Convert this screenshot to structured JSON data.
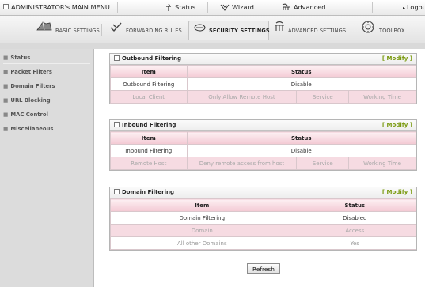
{
  "topbar": {
    "admin_label": "ADMINISTRATOR's MAIN MENU",
    "status_label": "Status",
    "wizard_label": "Wizard",
    "advanced_label": "Advanced",
    "logout_label": "Logout"
  },
  "tabs": [
    {
      "label": "BASIC SETTINGS",
      "icon": "basic-settings-icon"
    },
    {
      "label": "FORWARDING RULES",
      "icon": "forwarding-icon"
    },
    {
      "label": "SECURITY SETTINGS",
      "icon": "security-icon",
      "active": true
    },
    {
      "label": "ADVANCED SETTINGS",
      "icon": "advanced-icon"
    },
    {
      "label": "TOOLBOX",
      "icon": "toolbox-icon"
    }
  ],
  "sidebar": {
    "items": [
      {
        "label": "Status"
      },
      {
        "label": "Packet Filters"
      },
      {
        "label": "Domain Filters"
      },
      {
        "label": "URL Blocking"
      },
      {
        "label": "MAC Control"
      },
      {
        "label": "Miscellaneous"
      }
    ]
  },
  "outbound": {
    "title": "Outbound Filtering",
    "modify": "[ Modify ]",
    "col_item": "Item",
    "col_status": "Status",
    "row_item": "Outbound Filtering",
    "row_status": "Disable",
    "sub": [
      "Local Client",
      "Only Allow Remote Host",
      "Service",
      "Working Time"
    ]
  },
  "inbound": {
    "title": "Inbound Filtering",
    "modify": "[ Modify ]",
    "col_item": "Item",
    "col_status": "Status",
    "row_item": "Inbound Filtering",
    "row_status": "Disable",
    "sub": [
      "Remote Host",
      "Deny remote access from host",
      "Service",
      "Working Time"
    ]
  },
  "domain": {
    "title": "Domain Filtering",
    "modify": "[ Modify ]",
    "col_item": "Item",
    "col_status": "Status",
    "row_item": "Domain Filtering",
    "row_status": "Disabled",
    "sub_domain": "Domain",
    "sub_access": "Access",
    "other_domain": "All other Domains",
    "other_access": "Yes"
  },
  "refresh_label": "Refresh"
}
